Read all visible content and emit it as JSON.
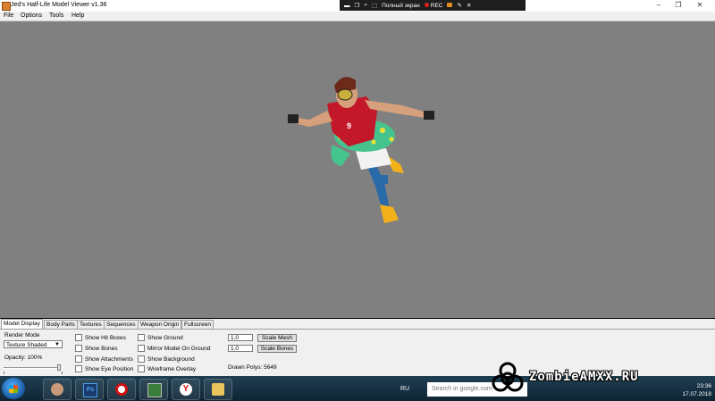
{
  "window": {
    "title": "Jed's Half-Life Model Viewer v1.36"
  },
  "recorder": {
    "screen_label": "Полный экран",
    "rec_label": "REC"
  },
  "menu": [
    "File",
    "Options",
    "Tools",
    "Help"
  ],
  "tabs": [
    "Model Display",
    "Body Parts",
    "Textures",
    "Sequences",
    "Weapon Origin",
    "Fullscreen"
  ],
  "panel": {
    "render_mode_label": "Render Mode",
    "render_mode_value": "Texture Shaded",
    "opacity_label": "Opacity: 100%",
    "opacity_value": 1.0,
    "checkboxes_col1": [
      "Show Hit Boxes",
      "Show Bones",
      "Show Attachments",
      "Show Eye Position"
    ],
    "checkboxes_col2": [
      "Show Ground",
      "Mirror Model On Ground",
      "Show Background",
      "Wireframe Overlay"
    ],
    "scale_mesh_value": "1.0",
    "scale_mesh_button": "Scale Mesh",
    "scale_bones_value": "1.0",
    "scale_bones_button": "Scale Bones",
    "drawn_polys": "Drawn Polys: 5649"
  },
  "taskbar": {
    "lang": "RU",
    "search_placeholder": "Search in google.com",
    "time": "23:36",
    "date": "17.07.2018",
    "apps": [
      "avatar-app",
      "photoshop",
      "recorder-app",
      "monitor-app",
      "yandex-browser",
      "file-explorer"
    ]
  },
  "watermark": {
    "text": "ZombieAMXX.RU"
  },
  "colors": {
    "viewport": "#808080",
    "panel": "#f0f0f0",
    "taskbar": "#173447",
    "accent_red": "#e02020"
  }
}
